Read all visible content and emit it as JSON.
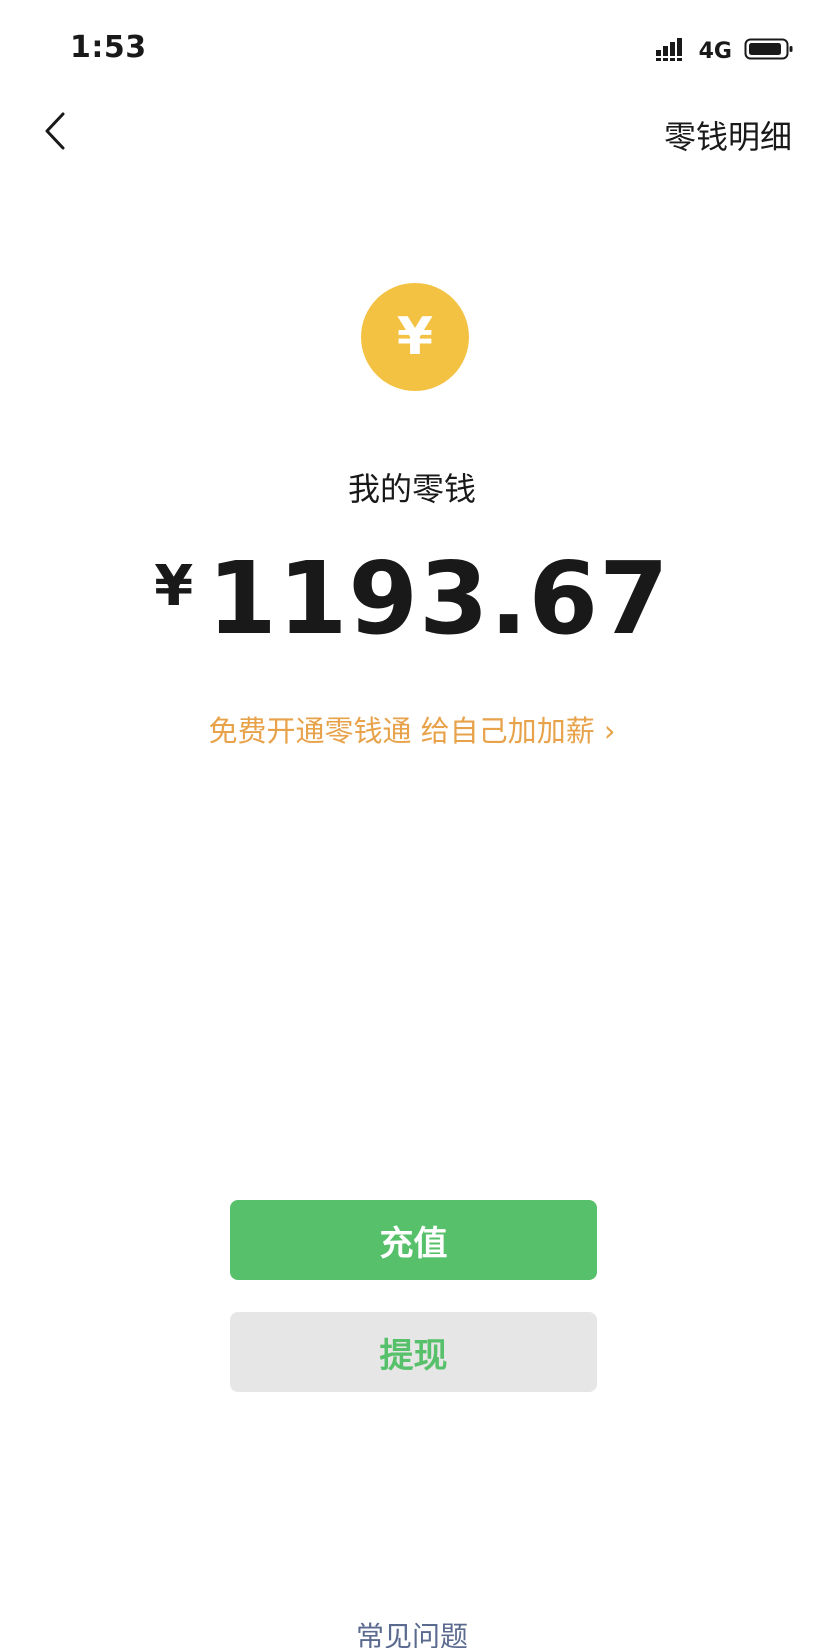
{
  "status_bar": {
    "time": "1:53",
    "network": "4G",
    "signal_icon": "signal-bars-icon",
    "battery_icon": "battery-icon"
  },
  "nav": {
    "back_icon": "chevron-left-icon",
    "detail_link": "零钱明细"
  },
  "wallet": {
    "coin_symbol": "¥",
    "title": "我的零钱",
    "currency": "¥",
    "amount": "1193.67"
  },
  "promo": {
    "text": "免费开通零钱通 给自己加加薪 ›"
  },
  "actions": {
    "recharge_label": "充值",
    "withdraw_label": "提现"
  },
  "footer": {
    "faq_label": "常见问题"
  },
  "colors": {
    "coin": "#f4c242",
    "primary_green": "#57c06a",
    "promo_orange": "#e7a24a",
    "link_blue_gray": "#5a6b8f"
  }
}
